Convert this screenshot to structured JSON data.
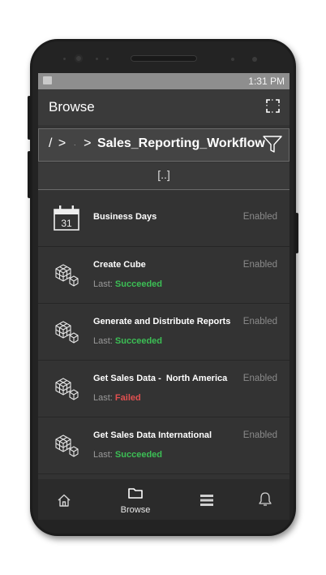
{
  "status_bar": {
    "time": "1:31 PM"
  },
  "app_bar": {
    "title": "Browse"
  },
  "path_bar": {
    "root": "/",
    "separator": ">",
    "current": "Sales_Reporting_Workflow"
  },
  "parent_folder": "[..]",
  "items": [
    {
      "name": "Business Days",
      "state": "Enabled",
      "icon": "calendar-icon",
      "calendar_day": "31"
    },
    {
      "name": "Create Cube",
      "state": "Enabled",
      "icon": "cubes-icon",
      "last_label": "Last:",
      "last_status": "Succeeded"
    },
    {
      "name": "Generate and Distribute Reports",
      "state": "Enabled",
      "icon": "cubes-icon",
      "last_label": "Last:",
      "last_status": "Succeeded"
    },
    {
      "name": "Get Sales Data -  North America",
      "state": "Enabled",
      "icon": "cubes-icon",
      "last_label": "Last:",
      "last_status": "Failed"
    },
    {
      "name": "Get Sales Data International",
      "state": "Enabled",
      "icon": "cubes-icon",
      "last_label": "Last:",
      "last_status": "Succeeded"
    }
  ],
  "nav": {
    "browse_label": "Browse"
  },
  "colors": {
    "succeeded": "#3cbf55",
    "failed": "#e05050",
    "screen_bg": "#333333"
  }
}
